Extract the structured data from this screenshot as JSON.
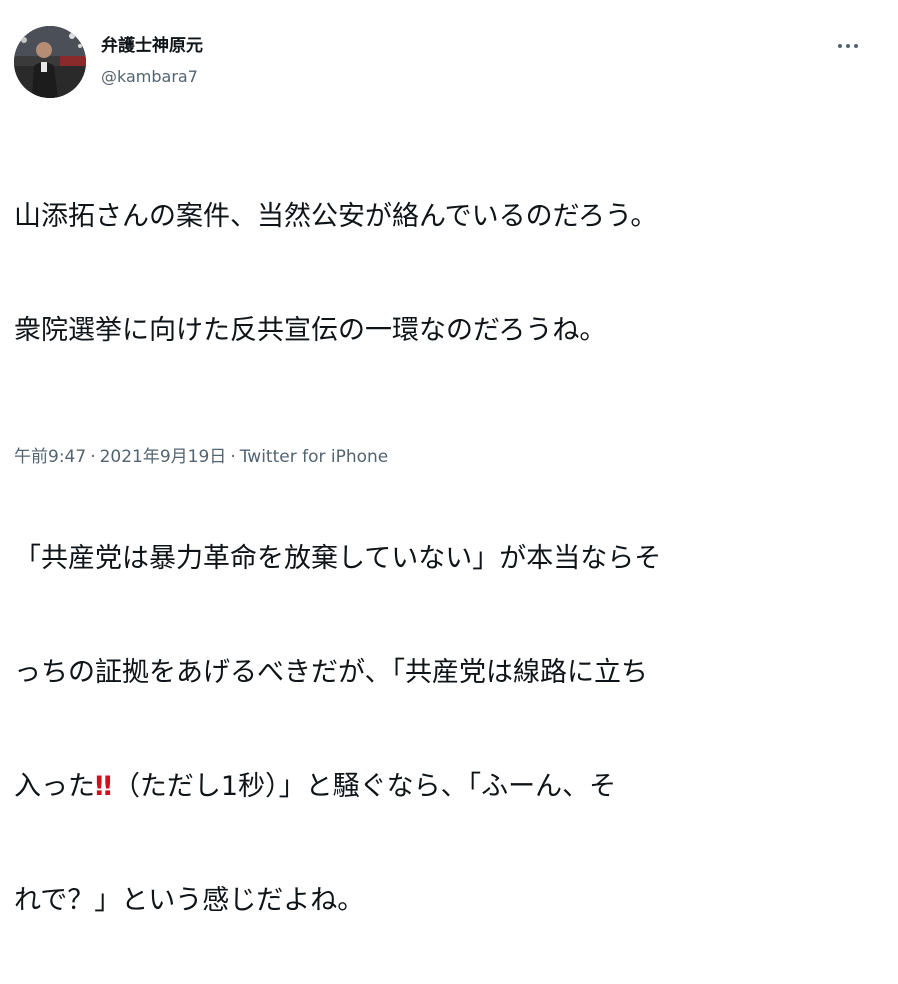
{
  "author": {
    "display_name": "弁護士神原元",
    "handle": "@kambara7",
    "avatar": "profile-photo"
  },
  "tweet": {
    "line1": "山添拓さんの案件、当然公安が絡んでいるのだろう。",
    "line2": "衆院選挙に向けた反共宣伝の一環なのだろうね。",
    "line3": "「共産党は暴力革命を放棄していない」が本当ならそ",
    "line4": "っちの証拠をあげるべきだが、「共産党は線路に立ち",
    "line5_pre": "入った",
    "line5_emoji": "‼",
    "line5_post": "（ただし1秒）」と騒ぐなら、「ふーん、そ",
    "line6": "れで？」という感じだよね。"
  },
  "meta": {
    "time": "午前9:47",
    "separator": "·",
    "date": "2021年9月19日",
    "source": "Twitter for iPhone"
  },
  "icons": {
    "more": "more-horizontal-icon",
    "emoji": "double-exclamation-emoji"
  },
  "colors": {
    "text_primary": "#0f1419",
    "text_secondary": "#536471",
    "emoji_red": "#d10f1f"
  }
}
